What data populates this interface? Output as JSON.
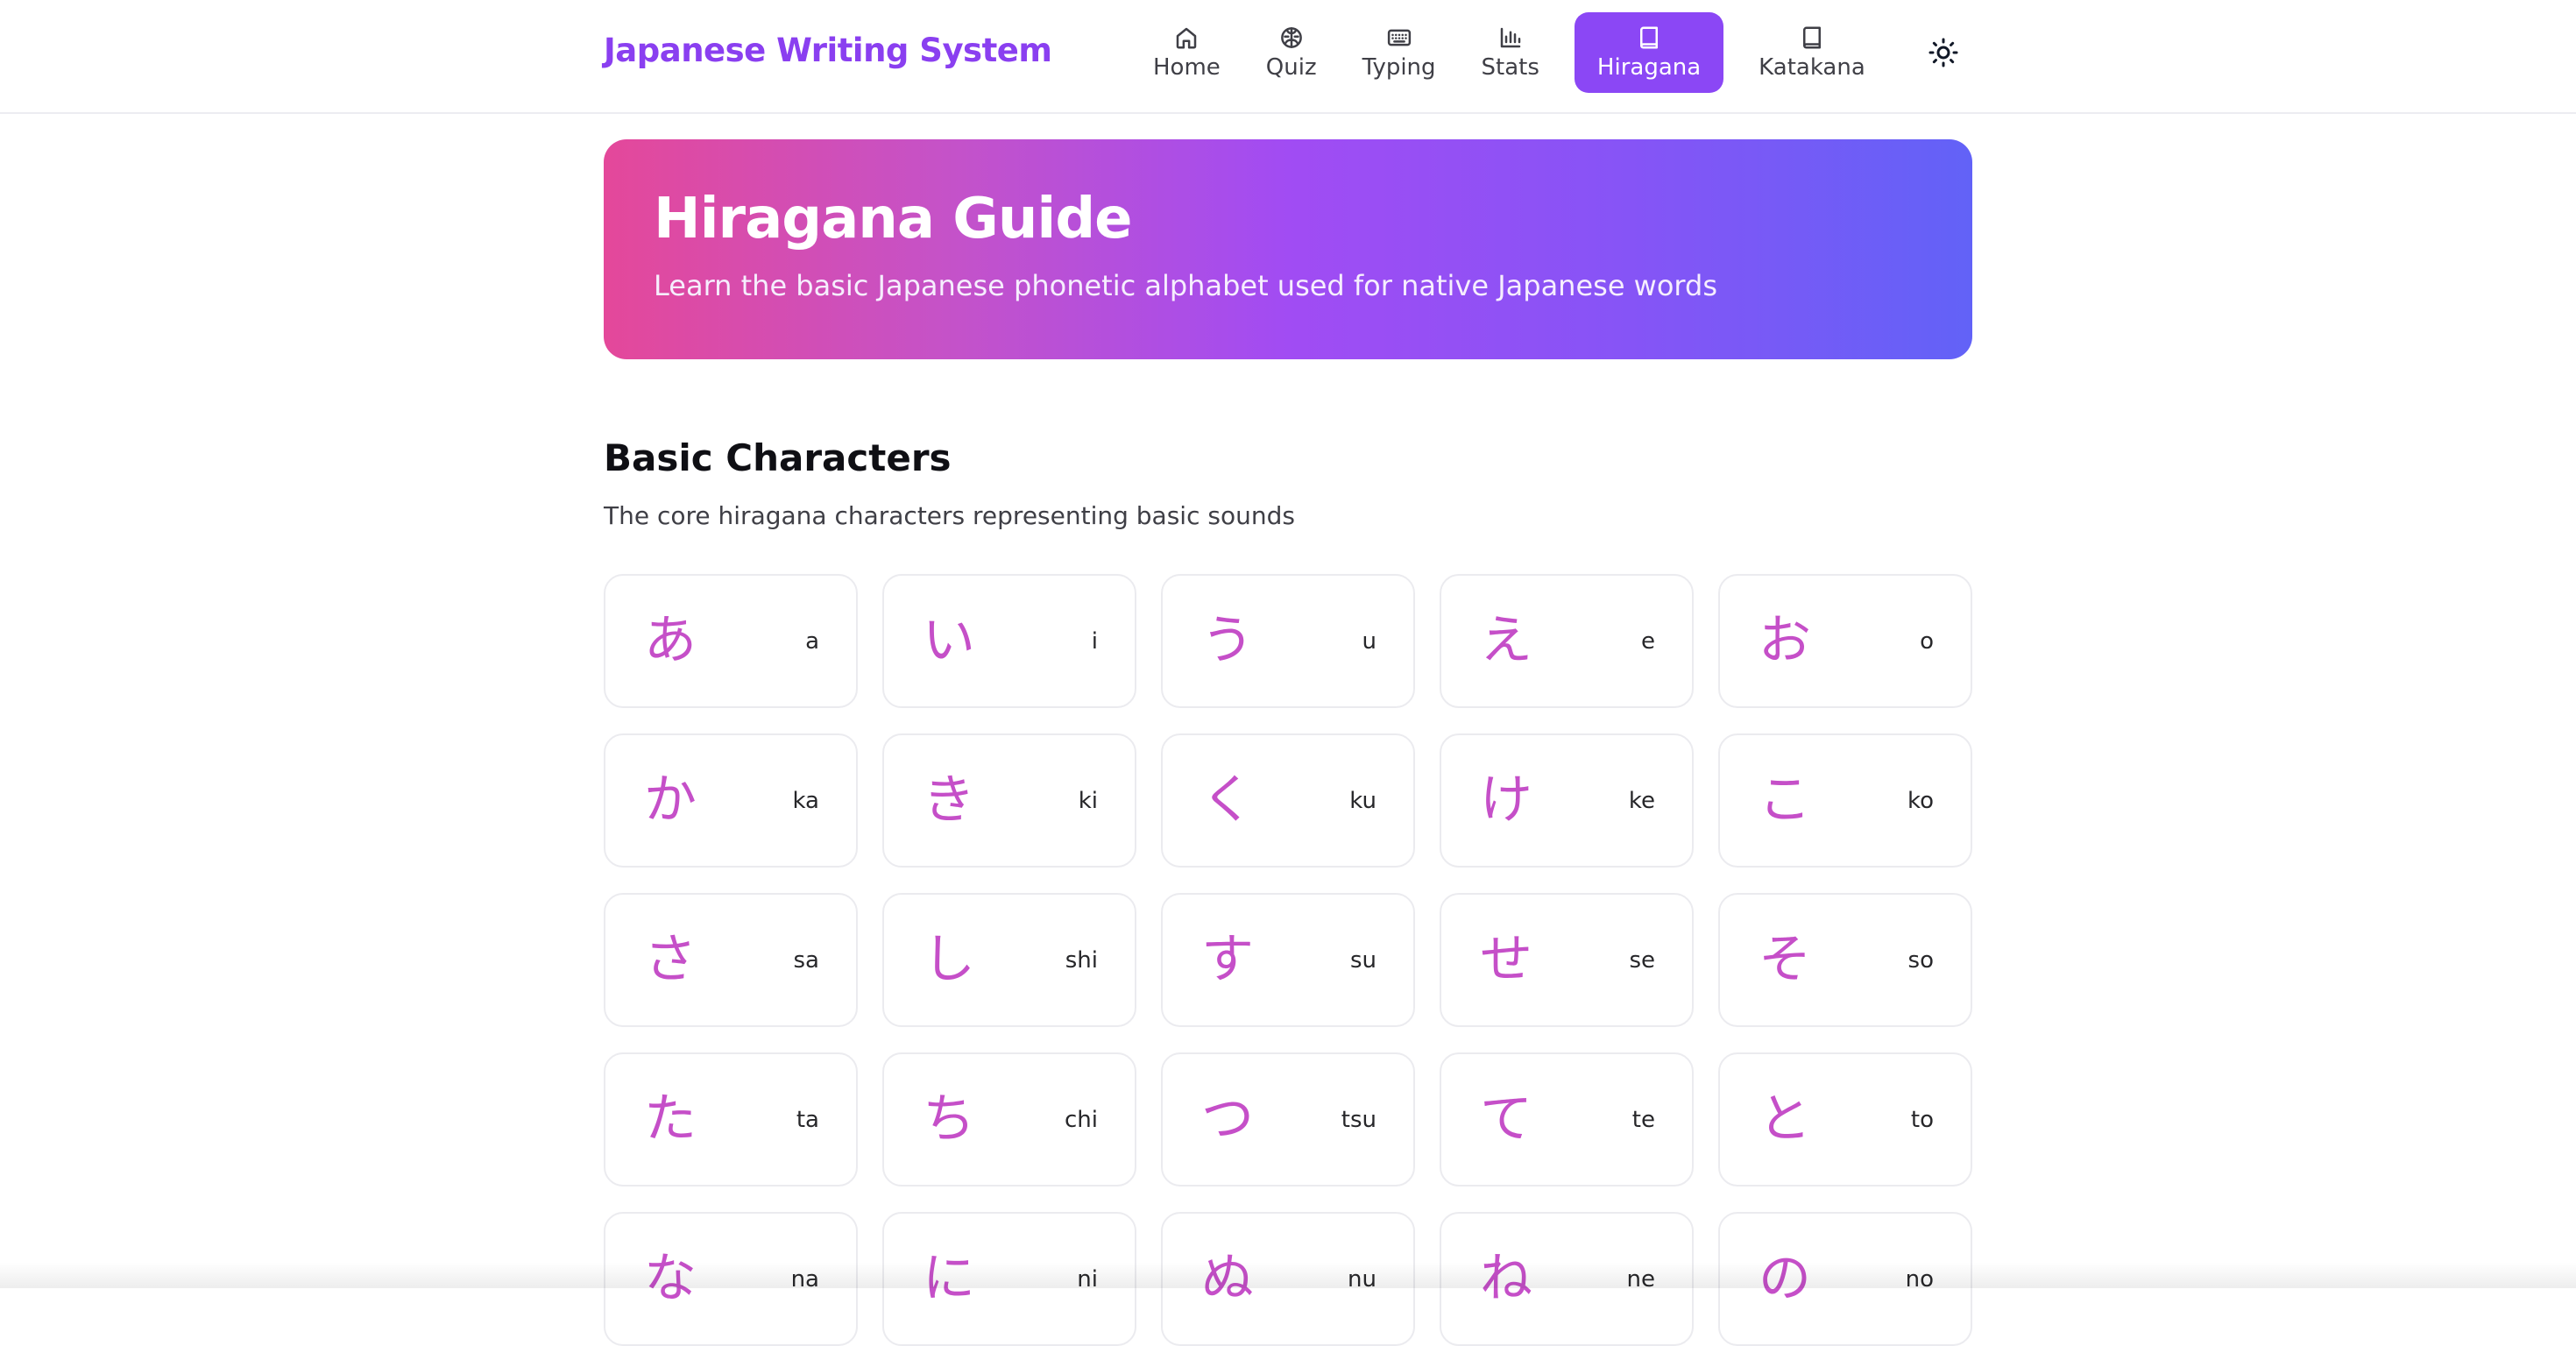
{
  "header": {
    "brand": "Japanese Writing System",
    "nav": [
      {
        "label": "Home",
        "icon": "home-icon"
      },
      {
        "label": "Quiz",
        "icon": "brain-icon"
      },
      {
        "label": "Typing",
        "icon": "keyboard-icon"
      },
      {
        "label": "Stats",
        "icon": "bar-chart-icon"
      },
      {
        "label": "Hiragana",
        "icon": "book-icon",
        "active": true
      },
      {
        "label": "Katakana",
        "icon": "book-icon"
      }
    ],
    "theme_toggle_icon": "sun-icon"
  },
  "hero": {
    "title": "Hiragana Guide",
    "subtitle": "Learn the basic Japanese phonetic alphabet used for native Japanese words"
  },
  "section": {
    "title": "Basic Characters",
    "subtitle": "The core hiragana characters representing basic sounds"
  },
  "characters": [
    {
      "kana": "あ",
      "romaji": "a"
    },
    {
      "kana": "い",
      "romaji": "i"
    },
    {
      "kana": "う",
      "romaji": "u"
    },
    {
      "kana": "え",
      "romaji": "e"
    },
    {
      "kana": "お",
      "romaji": "o"
    },
    {
      "kana": "か",
      "romaji": "ka"
    },
    {
      "kana": "き",
      "romaji": "ki"
    },
    {
      "kana": "く",
      "romaji": "ku"
    },
    {
      "kana": "け",
      "romaji": "ke"
    },
    {
      "kana": "こ",
      "romaji": "ko"
    },
    {
      "kana": "さ",
      "romaji": "sa"
    },
    {
      "kana": "し",
      "romaji": "shi"
    },
    {
      "kana": "す",
      "romaji": "su"
    },
    {
      "kana": "せ",
      "romaji": "se"
    },
    {
      "kana": "そ",
      "romaji": "so"
    },
    {
      "kana": "た",
      "romaji": "ta"
    },
    {
      "kana": "ち",
      "romaji": "chi"
    },
    {
      "kana": "つ",
      "romaji": "tsu"
    },
    {
      "kana": "て",
      "romaji": "te"
    },
    {
      "kana": "と",
      "romaji": "to"
    },
    {
      "kana": "な",
      "romaji": "na"
    },
    {
      "kana": "に",
      "romaji": "ni"
    },
    {
      "kana": "ぬ",
      "romaji": "nu"
    },
    {
      "kana": "ね",
      "romaji": "ne"
    },
    {
      "kana": "の",
      "romaji": "no"
    }
  ],
  "colors": {
    "brand": "#8a3ff0",
    "active_nav": "#8b47f5",
    "kana": "#c54fc8",
    "hero_gradient": [
      "#e4489a",
      "#a14cf3",
      "#6262f7"
    ]
  }
}
